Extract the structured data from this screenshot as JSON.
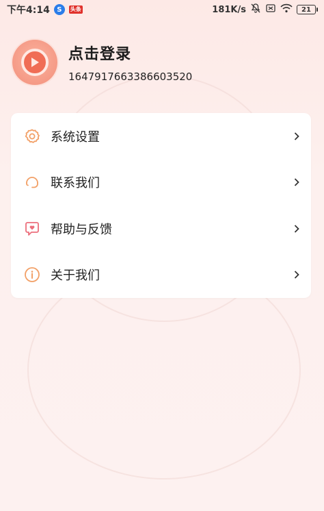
{
  "status_bar": {
    "time": "下午4:14",
    "app_icon_letter": "S",
    "badge_text": "头条",
    "network_speed": "181K/s",
    "battery_level": "21"
  },
  "profile": {
    "login_title": "点击登录",
    "user_id": "1647917663386603520"
  },
  "menu": {
    "items": [
      {
        "label": "系统设置",
        "icon": "gear-icon"
      },
      {
        "label": "联系我们",
        "icon": "headset-icon"
      },
      {
        "label": "帮助与反馈",
        "icon": "feedback-icon"
      },
      {
        "label": "关于我们",
        "icon": "info-icon"
      }
    ]
  },
  "colors": {
    "accent": "#f0876f",
    "icon_orange": "#f2a067",
    "icon_pink": "#ec6f7c",
    "background_top": "#fde9e6"
  }
}
